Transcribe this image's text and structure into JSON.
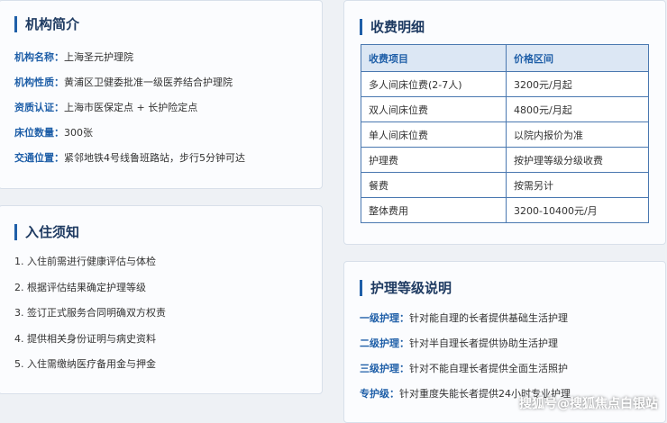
{
  "intro": {
    "title": "机构简介",
    "rows": [
      {
        "label": "机构名称：",
        "value": "上海圣元护理院"
      },
      {
        "label": "机构性质：",
        "value": "黄浦区卫健委批准一级医养结合护理院"
      },
      {
        "label": "资质认证：",
        "value": "上海市医保定点 + 长护险定点"
      },
      {
        "label": "床位数量：",
        "value": "300张"
      },
      {
        "label": "交通位置：",
        "value": "紧邻地铁4号线鲁班路站，步行5分钟可达"
      }
    ]
  },
  "admission": {
    "title": "入住须知",
    "items": [
      "1. 入住前需进行健康评估与体检",
      "2. 根据评估结果确定护理等级",
      "3. 签订正式服务合同明确双方权责",
      "4. 提供相关身份证明与病史资料",
      "5. 入住需缴纳医疗备用金与押金"
    ]
  },
  "fees": {
    "title": "收费明细",
    "headers": [
      "收费项目",
      "价格区间"
    ],
    "rows": [
      [
        "多人间床位费(2-7人)",
        "3200元/月起"
      ],
      [
        "双人间床位费",
        "4800元/月起"
      ],
      [
        "单人间床位费",
        "以院内报价为准"
      ],
      [
        "护理费",
        "按护理等级分级收费"
      ],
      [
        "餐费",
        "按需另计"
      ],
      [
        "整体费用",
        "3200-10400元/月"
      ]
    ]
  },
  "care_levels": {
    "title": "护理等级说明",
    "rows": [
      {
        "label": "一级护理：",
        "value": "针对能自理的长者提供基础生活护理"
      },
      {
        "label": "二级护理：",
        "value": "针对半自理长者提供协助生活护理"
      },
      {
        "label": "三级护理：",
        "value": "针对不能自理长者提供全面生活照护"
      },
      {
        "label": "专护级：",
        "value": "针对重度失能长者提供24小时专业护理"
      }
    ]
  },
  "watermark": "搜狐号@搜狐焦点白银站"
}
